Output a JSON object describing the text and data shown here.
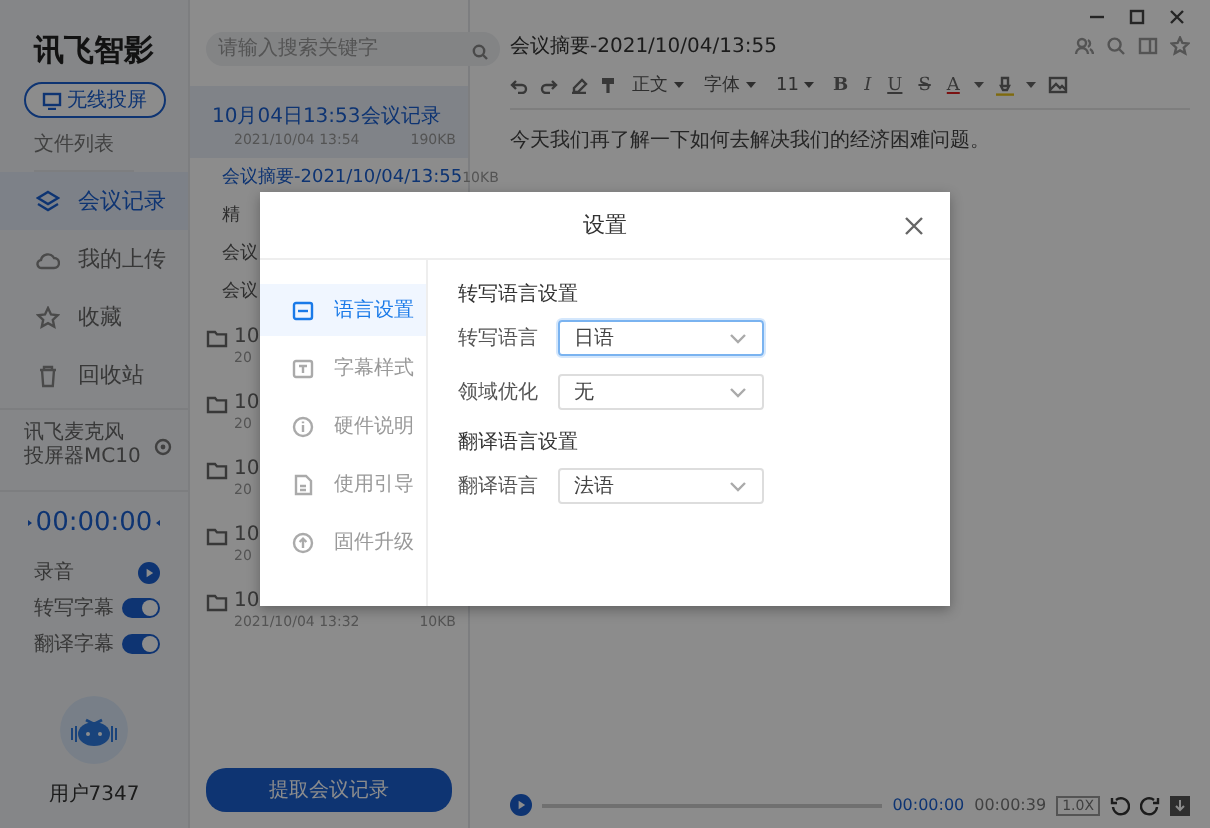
{
  "sidebar": {
    "logo": "讯飞智影",
    "cast_button": "无线投屏",
    "files_label": "文件列表",
    "nav": [
      {
        "label": "会议记录",
        "selected": true
      },
      {
        "label": "我的上传",
        "selected": false
      },
      {
        "label": "收藏",
        "selected": false
      },
      {
        "label": "回收站",
        "selected": false
      }
    ],
    "device": {
      "lines": [
        "讯飞麦克风",
        "投屏器MC10"
      ]
    },
    "timer": "00:00:00",
    "controls": [
      {
        "kind": "play",
        "label": "录音"
      },
      {
        "kind": "toggle",
        "label": "转写字幕",
        "on": true
      },
      {
        "kind": "toggle",
        "label": "翻译字幕",
        "on": true
      }
    ],
    "user": "用户7347"
  },
  "file_list": {
    "search": {
      "placeholder": "请输入搜索关键字"
    },
    "items": [
      {
        "name": "10月04日13:53会议记录",
        "date": "2021/10/04 13:54",
        "size": "190KB",
        "expanded": true,
        "children": [
          {
            "name": "会议摘要-2021/10/04/13:55",
            "size": "10KB",
            "selected": true
          },
          {
            "name": "精",
            "selected": false
          },
          {
            "name": "会议",
            "selected": false
          },
          {
            "name": "会议",
            "selected": false
          }
        ]
      },
      {
        "name": "10",
        "date": "20",
        "expanded": false
      },
      {
        "name": "10",
        "date": "20",
        "expanded": false
      },
      {
        "name": "10",
        "date": "20",
        "expanded": false
      },
      {
        "name": "10",
        "date": "20",
        "expanded": false
      },
      {
        "name": "10",
        "date": "2021/10/04 13:32",
        "size": "10KB",
        "expanded": false
      }
    ],
    "extract_button": "提取会议记录"
  },
  "editor": {
    "title": "会议摘要-2021/10/04/13:55",
    "toolbar": {
      "style": "正文",
      "font": "字体",
      "size": "11",
      "format": [
        "B",
        "I",
        "U",
        "S"
      ],
      "font_color": "A"
    },
    "body": "今天我们再了解一下如何去解决我们的经济困难问题。",
    "player": {
      "current": "00:00:00",
      "total": "00:00:39",
      "speed": "1.0X",
      "level": 0
    }
  },
  "dialog": {
    "title": "设置",
    "menu": [
      {
        "label": "语言设置",
        "selected": true
      },
      {
        "label": "字幕样式",
        "selected": false
      },
      {
        "label": "硬件说明",
        "selected": false
      },
      {
        "label": "使用引导",
        "selected": false
      },
      {
        "label": "固件升级",
        "selected": false
      }
    ],
    "sections": [
      {
        "heading": "转写语言设置",
        "fields": [
          {
            "label": "转写语言",
            "value": "日语",
            "focused": true
          },
          {
            "label": "领域优化",
            "value": "无",
            "focused": false
          }
        ]
      },
      {
        "heading": "翻译语言设置",
        "fields": [
          {
            "label": "翻译语言",
            "value": "法语",
            "focused": false
          }
        ]
      }
    ]
  }
}
